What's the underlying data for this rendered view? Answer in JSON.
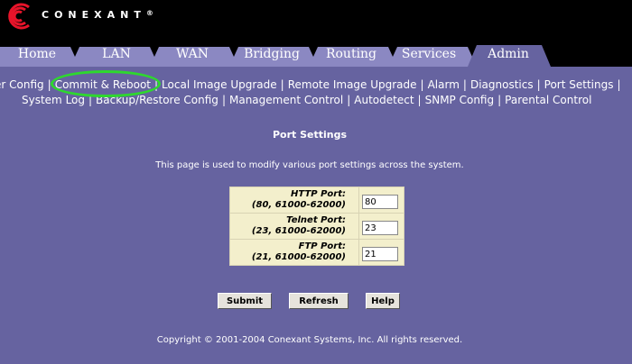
{
  "brand": {
    "name": "CONEXANT",
    "mark": "®"
  },
  "tabs": [
    {
      "label": "Home",
      "active": false
    },
    {
      "label": "LAN",
      "active": false
    },
    {
      "label": "WAN",
      "active": false
    },
    {
      "label": "Bridging",
      "active": false
    },
    {
      "label": "Routing",
      "active": false
    },
    {
      "label": "Services",
      "active": false
    },
    {
      "label": "Admin",
      "active": true
    }
  ],
  "subnav": {
    "row1": [
      "er Config",
      "Commit & Reboot",
      "Local Image Upgrade",
      "Remote Image Upgrade",
      "Alarm",
      "Diagnostics",
      "Port Settings"
    ],
    "row2": [
      "System Log",
      "Backup/Restore Config",
      "Management Control",
      "Autodetect",
      "SNMP Config",
      "Parental Control"
    ],
    "separator": "|"
  },
  "page": {
    "title": "Port Settings",
    "description": "This page is used to modify various port settings across the system."
  },
  "ports": [
    {
      "name": "HTTP Port:",
      "range": "(80, 61000-62000)",
      "value": "80"
    },
    {
      "name": "Telnet Port:",
      "range": "(23, 61000-62000)",
      "value": "23"
    },
    {
      "name": "FTP Port:",
      "range": "(21, 61000-62000)",
      "value": "21"
    }
  ],
  "buttons": {
    "submit": "Submit",
    "refresh": "Refresh",
    "help": "Help"
  },
  "footer": "Copyright © 2001-2004 Conexant Systems, Inc. All rights reserved.",
  "colors": {
    "background": "#6663a0",
    "tab_inactive": "#8b88c2",
    "tab_active": "#6663a0",
    "highlight": "#2ed82e",
    "form_cell": "#f3efcc"
  }
}
